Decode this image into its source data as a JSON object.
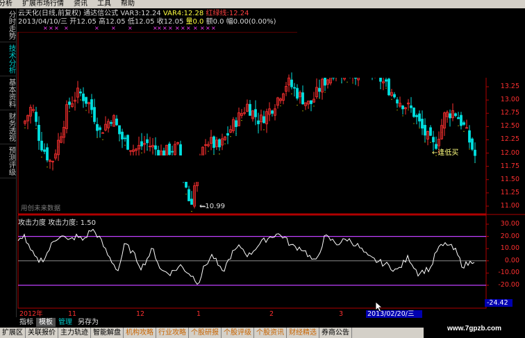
{
  "menu": [
    "分析",
    "扩展市场行情",
    "资讯",
    "工具",
    "帮助"
  ],
  "left_tabs": [
    {
      "label": "分时走势",
      "active": false
    },
    {
      "label": "技术分析",
      "active": true
    },
    {
      "label": "基本资料",
      "active": false
    },
    {
      "label": "财务透视",
      "active": false
    },
    {
      "label": "预测评级",
      "active": false
    }
  ],
  "header": {
    "name": "云天化(日线,前复权)",
    "formula": "通达信公式",
    "var3_label": "VAR3:",
    "var3_value": "12.24",
    "var4_label": "VAR4:",
    "var4_value": "12.28",
    "redgreen_label": "红绿线:",
    "redgreen_value": "12.24",
    "date": "2013/04/10/三",
    "open_label": "开",
    "open": "12.05",
    "high_label": "高",
    "high": "12.05",
    "low_label": "低",
    "low": "12.05",
    "close_label": "收",
    "close": "12.05",
    "vol_label": "量",
    "vol": "0.0",
    "amount_label": "额",
    "amount": "0.0",
    "range_label": "幅",
    "range": "0.00(0.00%)"
  },
  "signal_marks": [
    "×",
    "×",
    "×",
    "×",
    "×",
    "×",
    "×",
    "×",
    "×",
    "×",
    "×",
    "×",
    "×",
    "×",
    "×",
    "×",
    "×",
    "×"
  ],
  "price_axis": [
    "13.25",
    "13.00",
    "12.75",
    "12.50",
    "12.25",
    "12.00",
    "11.75",
    "11.50",
    "11.25",
    "11.00"
  ],
  "low_label": "←10.99",
  "stop_label": "←逢低买",
  "future_note": "用创未来数据",
  "indicator": {
    "title": "攻击力度",
    "line_label": "攻击力度:",
    "line_value": "1.50",
    "axis": [
      "30.00",
      "20.00",
      "10.00",
      "0.00",
      "-10.00",
      "-20.00"
    ],
    "upper_level": 20,
    "lower_level": -20,
    "current_value_box": "-24.42",
    "colors": {
      "line": "#ffffff",
      "bands": "#c040ff",
      "zero": "#a0a0a0"
    }
  },
  "date_axis": [
    "2012年",
    "11",
    "12",
    "1",
    "2",
    "3"
  ],
  "current_date": "2013/02/20/三",
  "bottom_tabs1": [
    {
      "label": "指标",
      "state": "normal"
    },
    {
      "label": "模板",
      "state": "selected"
    },
    {
      "label": "管理",
      "state": "active"
    },
    {
      "label": "另存为",
      "state": "normal"
    }
  ],
  "bottom_tabs2": [
    {
      "label": "扩展区",
      "color": "normal"
    },
    {
      "label": "关联报价",
      "color": "normal"
    },
    {
      "label": "主力轨迹",
      "color": "normal"
    },
    {
      "label": "智能解盘",
      "color": "normal"
    },
    {
      "label": "机构攻略",
      "color": "orange"
    },
    {
      "label": "行业攻略",
      "color": "orange"
    },
    {
      "label": "个股研报",
      "color": "orange"
    },
    {
      "label": "个股评级",
      "color": "orange"
    },
    {
      "label": "个股资讯",
      "color": "orange"
    },
    {
      "label": "财经精选",
      "color": "orange"
    },
    {
      "label": "券商公告",
      "color": "normal"
    }
  ],
  "watermark": "www.7gpzb.com",
  "colors": {
    "up": "#ff3030",
    "down": "#00e0e0",
    "axis_text": "#ff3030",
    "frame": "#b00000",
    "dots": "#c0c000"
  }
}
